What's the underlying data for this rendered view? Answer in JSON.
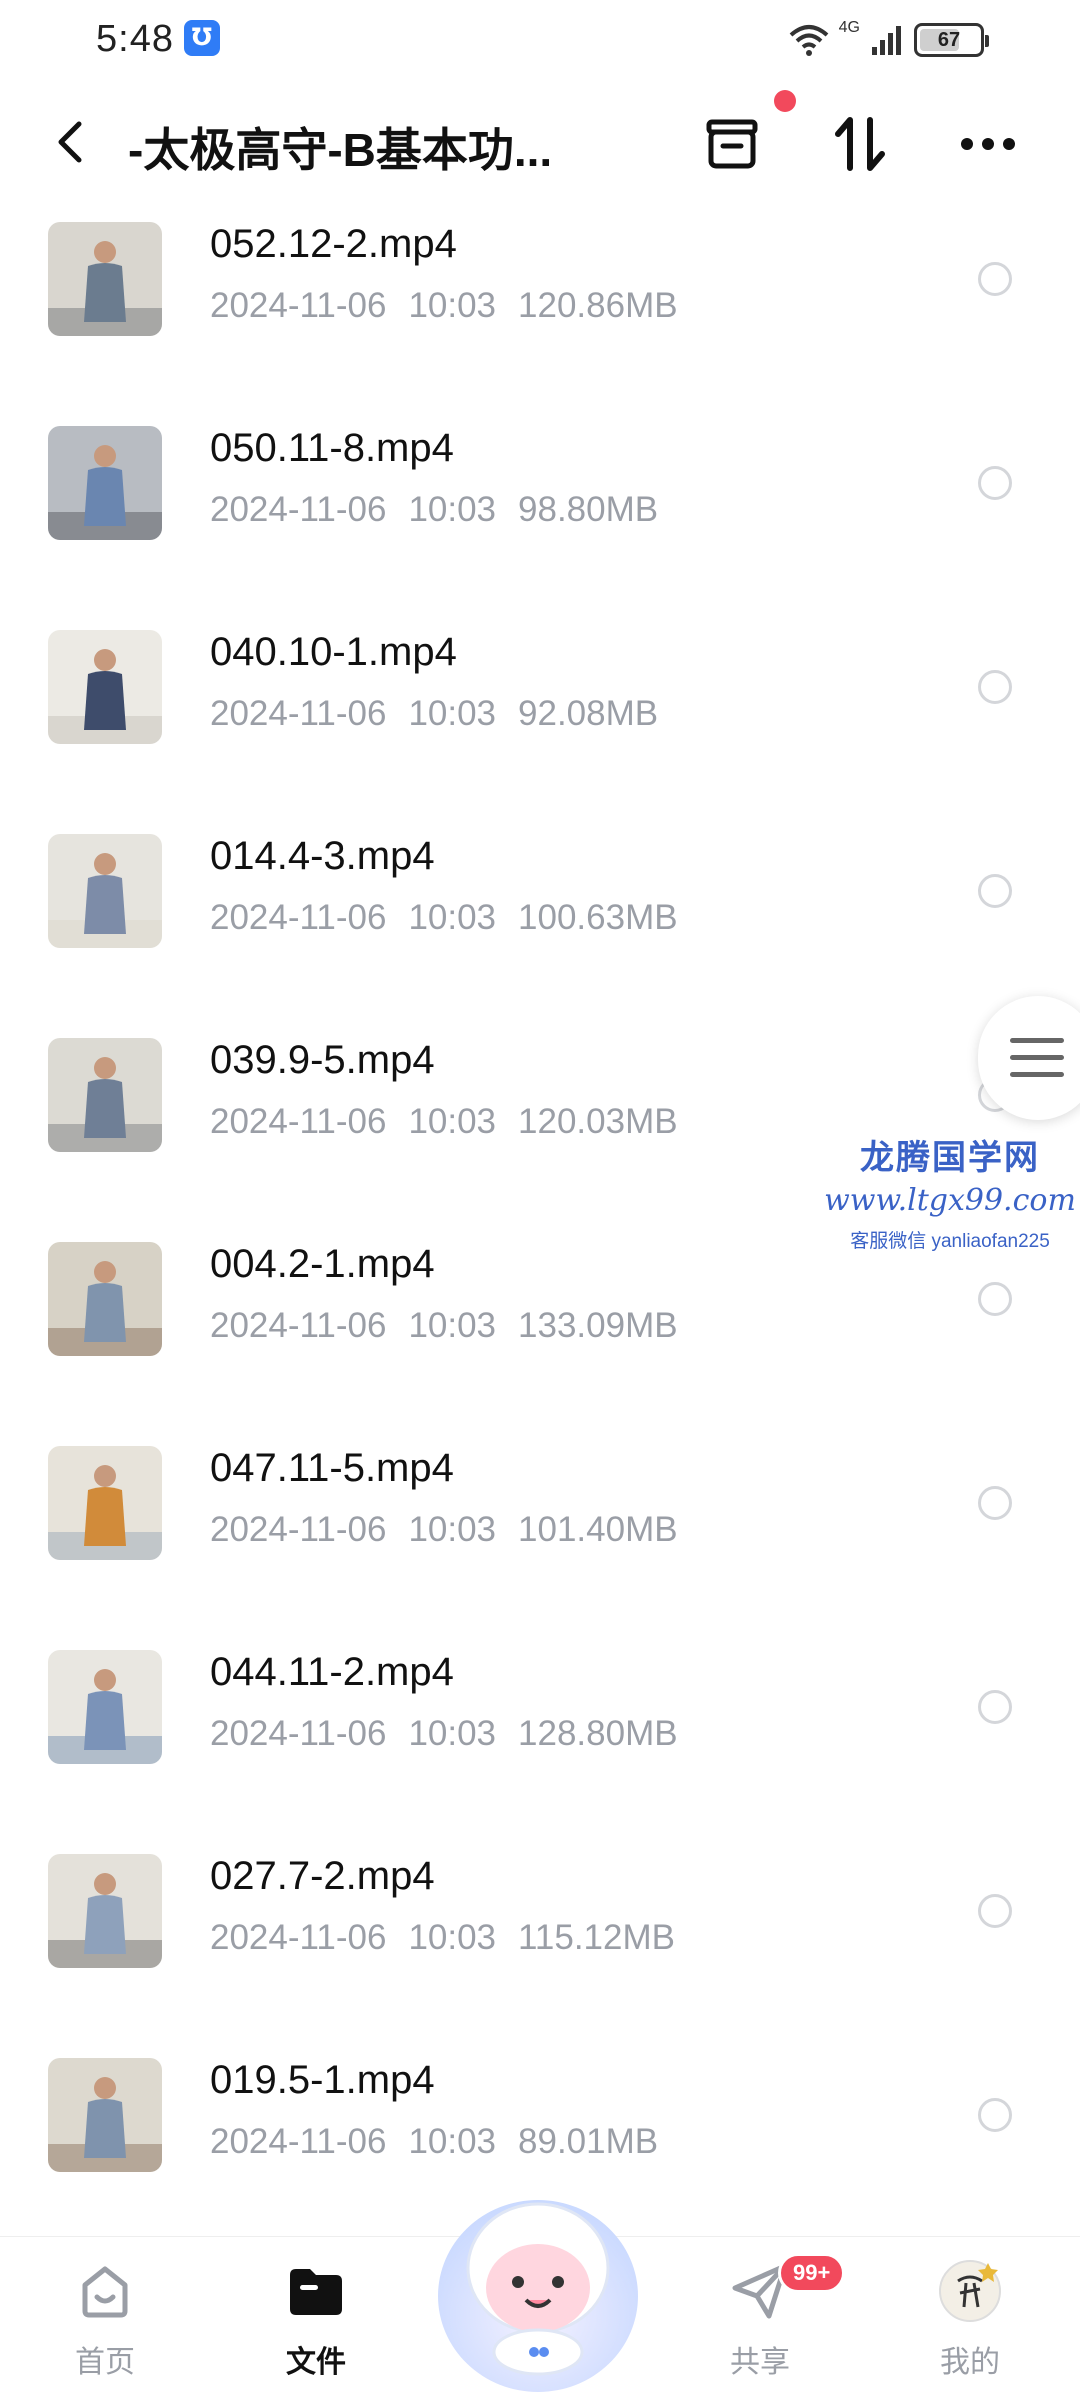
{
  "status_bar": {
    "time": "5:48",
    "app_badge": "℧",
    "network": "4G",
    "battery": "67",
    "battery_level": 0.67
  },
  "header": {
    "title": "-太极高守-B基本功...",
    "icons": [
      "back-icon",
      "archive-icon",
      "sort-icon",
      "more-icon"
    ],
    "notification_dot_color": "#f2495c"
  },
  "files": [
    {
      "name": "052.12-2.mp4",
      "date": "2024-11-06",
      "time": "10:03",
      "size": "120.86MB"
    },
    {
      "name": "050.11-8.mp4",
      "date": "2024-11-06",
      "time": "10:03",
      "size": "98.80MB"
    },
    {
      "name": "040.10-1.mp4",
      "date": "2024-11-06",
      "time": "10:03",
      "size": "92.08MB"
    },
    {
      "name": "014.4-3.mp4",
      "date": "2024-11-06",
      "time": "10:03",
      "size": "100.63MB"
    },
    {
      "name": "039.9-5.mp4",
      "date": "2024-11-06",
      "time": "10:03",
      "size": "120.03MB"
    },
    {
      "name": "004.2-1.mp4",
      "date": "2024-11-06",
      "time": "10:03",
      "size": "133.09MB"
    },
    {
      "name": "047.11-5.mp4",
      "date": "2024-11-06",
      "time": "10:03",
      "size": "101.40MB"
    },
    {
      "name": "044.11-2.mp4",
      "date": "2024-11-06",
      "time": "10:03",
      "size": "128.80MB"
    },
    {
      "name": "027.7-2.mp4",
      "date": "2024-11-06",
      "time": "10:03",
      "size": "115.12MB"
    },
    {
      "name": "019.5-1.mp4",
      "date": "2024-11-06",
      "time": "10:03",
      "size": "89.01MB"
    }
  ],
  "watermark": {
    "title": "龙腾国学网",
    "url": "www.ltgx99.com",
    "contact": "客服微信 yanliaofan225"
  },
  "bottom_nav": {
    "items": [
      {
        "label": "首页",
        "icon": "home-icon"
      },
      {
        "label": "文件",
        "icon": "folder-icon",
        "active": true
      },
      {
        "label": "共享",
        "icon": "share-plane-icon",
        "badge": "99+"
      },
      {
        "label": "我的",
        "icon": "profile-avatar-icon"
      }
    ]
  },
  "colors": {
    "accent": "#f2495c",
    "meta_text": "#9a9ea6",
    "watermark": "#3a62c6"
  }
}
